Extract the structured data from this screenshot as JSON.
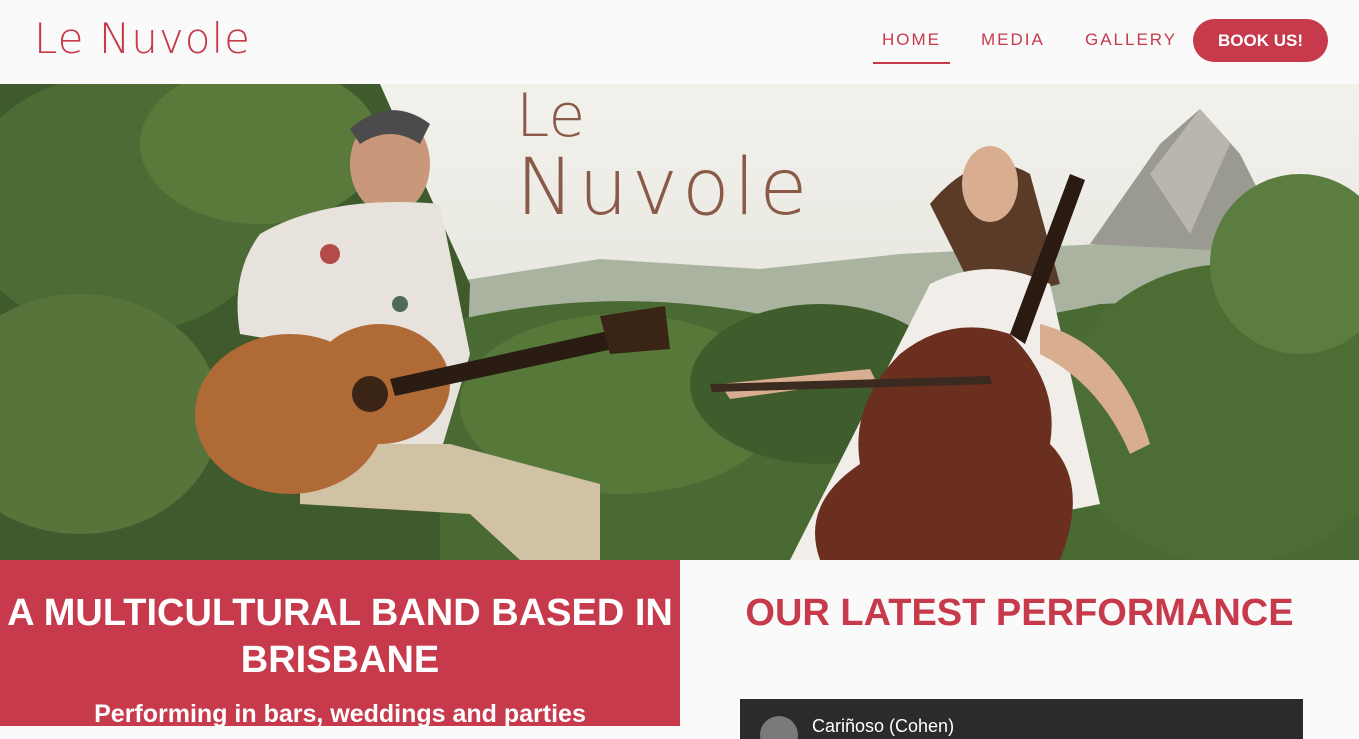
{
  "brand": {
    "logo_text": "Le Nuvole"
  },
  "nav": {
    "items": [
      {
        "label": "HOME",
        "active": true
      },
      {
        "label": "MEDIA",
        "active": false
      },
      {
        "label": "GALLERY",
        "active": false
      }
    ],
    "cta_label": "BOOK US!"
  },
  "hero": {
    "overlay_line1": "Le",
    "overlay_line2": "Nuvole"
  },
  "intro": {
    "title": "A MULTICULTURAL BAND BASED IN BRISBANE",
    "subtitle": "Performing in bars, weddings and parties"
  },
  "latest": {
    "title": "OUR LATEST PERFORMANCE",
    "video_title": "Cariñoso (Cohen)"
  },
  "colors": {
    "accent": "#c73a4b",
    "background": "#fafafa"
  }
}
